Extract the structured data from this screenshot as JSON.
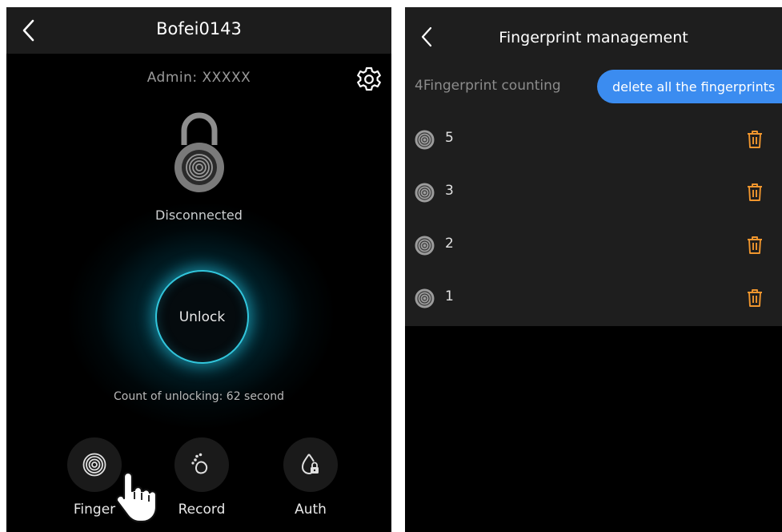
{
  "left_screen": {
    "title": "Bofei0143",
    "admin_text": "Admin: XXXXX",
    "status": "Disconnected",
    "unlock_label": "Unlock",
    "count_text": "Count of unlocking: 62 second",
    "tabs": [
      {
        "label": "Finger",
        "icon": "fingerprint-icon"
      },
      {
        "label": "Record",
        "icon": "footprint-icon"
      },
      {
        "label": "Auth",
        "icon": "auth-lock-drop-icon"
      }
    ],
    "icons": {
      "back": "back-chevron-icon",
      "settings": "gear-icon",
      "lock": "padlock-fingerprint-icon",
      "pointer": "hand-pointer-icon"
    },
    "colors": {
      "accent_ring": "#32c6dc",
      "background": "#000000",
      "header": "#1c1c1c"
    }
  },
  "right_screen": {
    "title": "Fingerprint management",
    "counting_text": "4Fingerprint counting",
    "delete_all_label": "delete all the fingerprints",
    "fingerprints": [
      {
        "label": "5"
      },
      {
        "label": "3"
      },
      {
        "label": "2"
      },
      {
        "label": "1"
      }
    ],
    "icons": {
      "back": "back-chevron-icon",
      "item": "fingerprint-icon",
      "delete": "trash-icon"
    },
    "colors": {
      "button": "#3b8cf0",
      "trash": "#f0962e",
      "panel": "#1e1e1e"
    }
  }
}
